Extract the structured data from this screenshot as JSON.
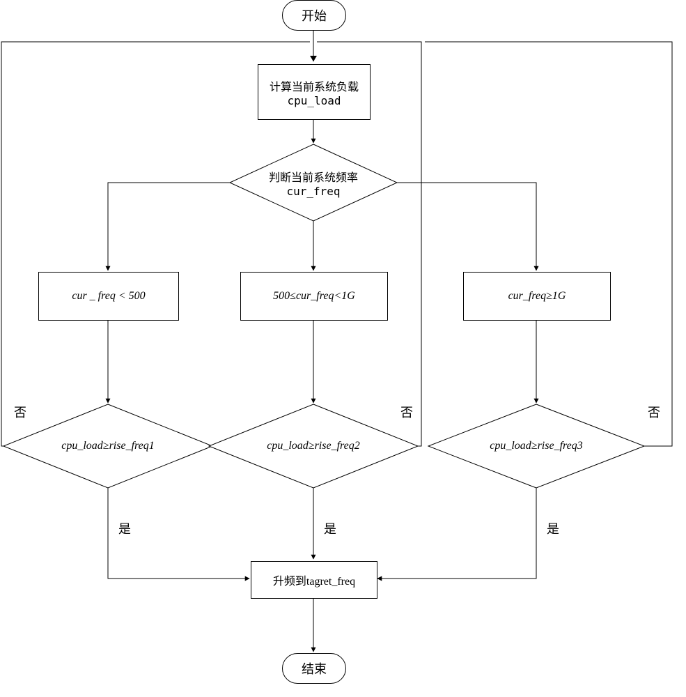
{
  "chart_data": {
    "type": "flowchart",
    "nodes": [
      {
        "id": "start",
        "kind": "terminal",
        "label": "开始"
      },
      {
        "id": "calc",
        "kind": "process",
        "label_line1": "计算当前系统负载",
        "label_line2": "cpu_load"
      },
      {
        "id": "judge",
        "kind": "decision",
        "label_line1": "判断当前系统频率",
        "label_line2": "cur_freq"
      },
      {
        "id": "b1",
        "kind": "process",
        "label": "cur _ freq < 500"
      },
      {
        "id": "b2",
        "kind": "process",
        "label": "500≤cur_freq<1G"
      },
      {
        "id": "b3",
        "kind": "process",
        "label": "cur_freq≥1G"
      },
      {
        "id": "d1",
        "kind": "decision",
        "label": "cpu_load≥rise_freq1"
      },
      {
        "id": "d2",
        "kind": "decision",
        "label": "cpu_load≥rise_freq2"
      },
      {
        "id": "d3",
        "kind": "decision",
        "label": "cpu_load≥rise_freq3"
      },
      {
        "id": "up",
        "kind": "process",
        "label": "升频到tagret_freq"
      },
      {
        "id": "end",
        "kind": "terminal",
        "label": "结束"
      }
    ],
    "labels": {
      "start": "开始",
      "end": "结束",
      "calc_line1": "计算当前系统负载",
      "calc_line2": "cpu_load",
      "judge_line1": "判断当前系统频率",
      "judge_line2": "cur_freq",
      "b1": "cur _ freq < 500",
      "b2": "500≤cur_freq<1G",
      "b3": "cur_freq≥1G",
      "d1": "cpu_load≥rise_freq1",
      "d2": "cpu_load≥rise_freq2",
      "d3": "cpu_load≥rise_freq3",
      "up": "升频到tagret_freq",
      "yes": "是",
      "no": "否"
    },
    "edges": [
      {
        "from": "start",
        "to": "calc"
      },
      {
        "from": "calc",
        "to": "judge"
      },
      {
        "from": "judge",
        "to": "b1"
      },
      {
        "from": "judge",
        "to": "b2"
      },
      {
        "from": "judge",
        "to": "b3"
      },
      {
        "from": "b1",
        "to": "d1"
      },
      {
        "from": "b2",
        "to": "d2"
      },
      {
        "from": "b3",
        "to": "d3"
      },
      {
        "from": "d1",
        "to": "up",
        "label": "是"
      },
      {
        "from": "d2",
        "to": "up",
        "label": "是"
      },
      {
        "from": "d3",
        "to": "up",
        "label": "是"
      },
      {
        "from": "d1",
        "to": "calc",
        "label": "否"
      },
      {
        "from": "d2",
        "to": "calc",
        "label": "否"
      },
      {
        "from": "d3",
        "to": "calc",
        "label": "否"
      },
      {
        "from": "up",
        "to": "end"
      }
    ]
  }
}
